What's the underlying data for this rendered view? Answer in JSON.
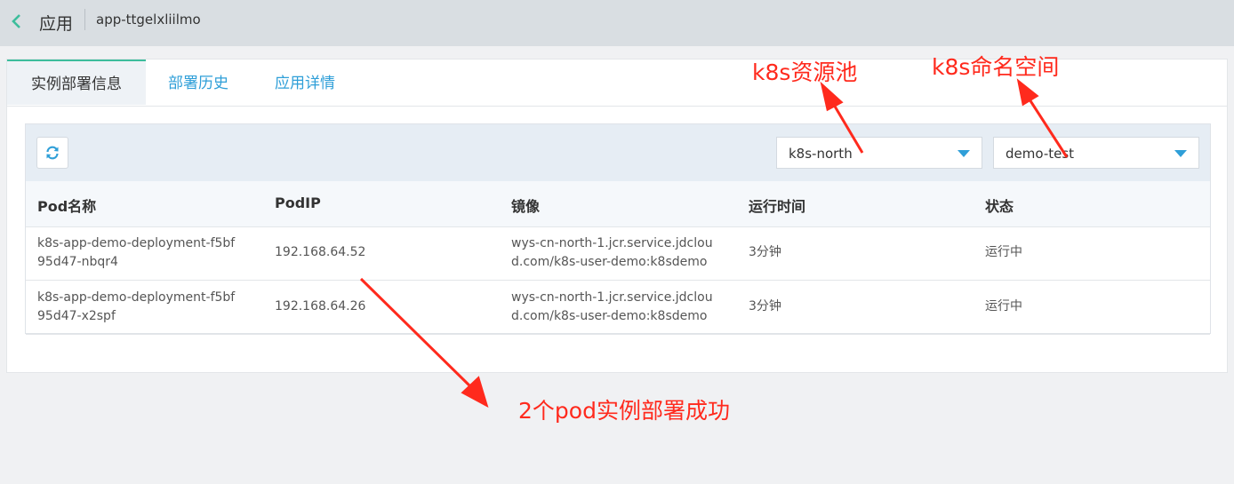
{
  "header": {
    "back_icon": "chevron-left-icon",
    "parent": "应用",
    "current": "app-ttgelxliilmo"
  },
  "tabs": [
    {
      "label": "实例部署信息",
      "active": true
    },
    {
      "label": "部署历史",
      "active": false
    },
    {
      "label": "应用详情",
      "active": false
    }
  ],
  "toolbar": {
    "refresh_icon": "refresh-icon",
    "pool_select": "k8s-north",
    "namespace_select": "demo-test"
  },
  "table": {
    "columns": [
      "Pod名称",
      "PodIP",
      "镜像",
      "运行时间",
      "状态"
    ],
    "rows": [
      {
        "name_line1": "k8s-app-demo-deployment-f5bf",
        "name_line2": "95d47-nbqr4",
        "ip": "192.168.64.52",
        "image_line1": "wys-cn-north-1.jcr.service.jdclou",
        "image_line2": "d.com/k8s-user-demo:k8sdemo",
        "uptime": "3分钟",
        "status": "运行中"
      },
      {
        "name_line1": "k8s-app-demo-deployment-f5bf",
        "name_line2": "95d47-x2spf",
        "ip": "192.168.64.26",
        "image_line1": "wys-cn-north-1.jcr.service.jdclou",
        "image_line2": "d.com/k8s-user-demo:k8sdemo",
        "uptime": "3分钟",
        "status": "运行中"
      }
    ]
  },
  "annotations": {
    "pool": "k8s资源池",
    "namespace": "k8s命名空间",
    "success": "2个pod实例部署成功"
  },
  "colors": {
    "accent": "#2f9fd8",
    "tab_indicator": "#3dbd9c",
    "annotation": "#ff2a1d",
    "topbar": "#d9dee2"
  }
}
